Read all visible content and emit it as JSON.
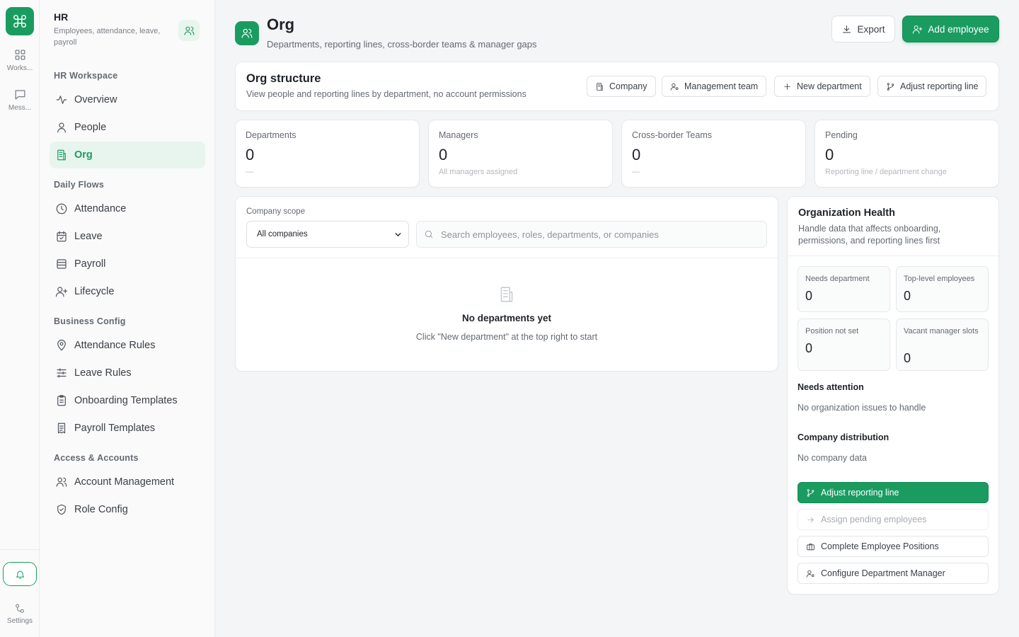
{
  "rail": {
    "items": [
      {
        "label": "Works...",
        "icon": "grid-icon"
      },
      {
        "label": "Mess...",
        "icon": "message-icon"
      }
    ],
    "settings_label": "Settings"
  },
  "sidebar": {
    "title": "HR",
    "subtitle": "Employees, attendance, leave, payroll",
    "sections": {
      "workspace": "HR Workspace",
      "daily": "Daily Flows",
      "config": "Business Config",
      "access": "Access & Accounts"
    },
    "items": {
      "overview": "Overview",
      "people": "People",
      "org": "Org",
      "attendance": "Attendance",
      "leave": "Leave",
      "payroll": "Payroll",
      "lifecycle": "Lifecycle",
      "attendance_rules": "Attendance Rules",
      "leave_rules": "Leave Rules",
      "onboarding_templates": "Onboarding Templates",
      "payroll_templates": "Payroll Templates",
      "account_management": "Account Management",
      "role_config": "Role Config"
    }
  },
  "header": {
    "title": "Org",
    "subtitle": "Departments, reporting lines, cross-border teams & manager gaps",
    "export_label": "Export",
    "add_label": "Add employee"
  },
  "org_structure": {
    "title": "Org structure",
    "subtitle": "View people and reporting lines by department, no account permissions",
    "buttons": {
      "company": "Company",
      "management": "Management team",
      "new_department": "New department",
      "adjust": "Adjust reporting line"
    }
  },
  "stats": [
    {
      "label": "Departments",
      "value": "0",
      "note": "—"
    },
    {
      "label": "Managers",
      "value": "0",
      "note": "All managers assigned"
    },
    {
      "label": "Cross-border Teams",
      "value": "0",
      "note": "—"
    },
    {
      "label": "Pending",
      "value": "0",
      "note": "Reporting line / department change"
    }
  ],
  "scope": {
    "label": "Company scope",
    "selected": "All companies",
    "search_placeholder": "Search employees, roles, departments, or companies",
    "empty_title": "No departments yet",
    "empty_sub": "Click \"New department\" at the top right to start"
  },
  "health": {
    "title": "Organization Health",
    "subtitle": "Handle data that affects onboarding, permissions, and reporting lines first",
    "metrics": [
      {
        "label": "Needs department",
        "value": "0"
      },
      {
        "label": "Top-level employees",
        "value": "0"
      },
      {
        "label": "Position not set",
        "value": "0"
      },
      {
        "label": "Vacant manager slots",
        "value": "0"
      }
    ],
    "attention_title": "Needs attention",
    "attention_text": "No organization issues to handle",
    "distribution_title": "Company distribution",
    "distribution_text": "No company data",
    "actions": {
      "adjust": "Adjust reporting line",
      "assign": "Assign pending employees",
      "positions": "Complete Employee Positions",
      "manager": "Configure Department Manager"
    }
  },
  "colors": {
    "accent": "#1a9c61",
    "accent_light": "#e8f5ee"
  }
}
